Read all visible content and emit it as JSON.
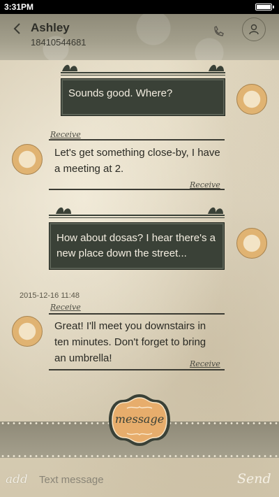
{
  "status_bar": {
    "time": "3:31PM"
  },
  "header": {
    "name": "Ashley",
    "number": "18410544681",
    "back": "<"
  },
  "messages": [
    {
      "type": "sent",
      "text": "Sounds good. Where?"
    },
    {
      "type": "received",
      "label": "Receive",
      "text_lines": [
        "Let's get something close-by, I have",
        "a meeting at 2."
      ]
    },
    {
      "type": "sent",
      "text_lines": [
        "How about dosas? I hear there's a",
        "new place down the street..."
      ]
    },
    {
      "type": "received",
      "timestamp": "2015-12-16 11:48",
      "label": "Receive",
      "text_lines": [
        "Great! I'll meet you downstairs in",
        "ten minutes. Don't forget to bring",
        "an umbrella!"
      ]
    }
  ],
  "bottom": {
    "badge_label": "message",
    "add_label": "add",
    "input_placeholder": "Text message",
    "send_label": "Send"
  },
  "colors": {
    "bubble": "#3a4137",
    "accent_orange": "#e0a96a",
    "paper": "#dcd2bb"
  }
}
